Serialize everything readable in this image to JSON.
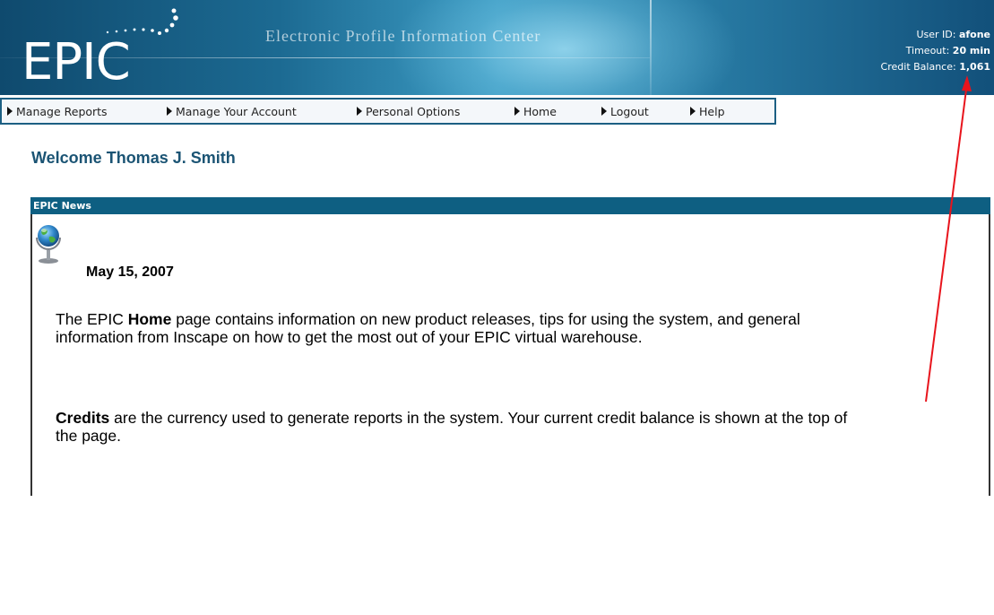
{
  "header": {
    "logo": "EPIC",
    "tagline": "Electronic Profile Information Center",
    "user_id_label": "User ID:",
    "user_id": "afone",
    "timeout_label": "Timeout:",
    "timeout": "20 min",
    "credit_label": "Credit Balance:",
    "credit": "1,061"
  },
  "nav": {
    "items": [
      {
        "label": "Manage Reports"
      },
      {
        "label": "Manage Your Account"
      },
      {
        "label": "Personal Options"
      },
      {
        "label": "Home"
      },
      {
        "label": "Logout"
      },
      {
        "label": "Help"
      }
    ]
  },
  "welcome": "Welcome Thomas J. Smith",
  "news": {
    "title": "EPIC News",
    "date": "May 15, 2007",
    "para1": {
      "pre": "The EPIC ",
      "bold": "Home",
      "post": " page contains information on new product releases, tips for using the system, and general information from Inscape on how to get the most out of your EPIC virtual warehouse."
    },
    "para2": {
      "bold": "Credits",
      "post": " are the currency used to generate reports in the system. Your current credit balance is shown at the top of the page."
    }
  },
  "colors": {
    "header_dark": "#0f4a6e",
    "header_light": "#3d9cc4",
    "news_bar": "#0e5f82",
    "welcome_text": "#1b5474",
    "annotation_arrow": "#e8141c"
  }
}
